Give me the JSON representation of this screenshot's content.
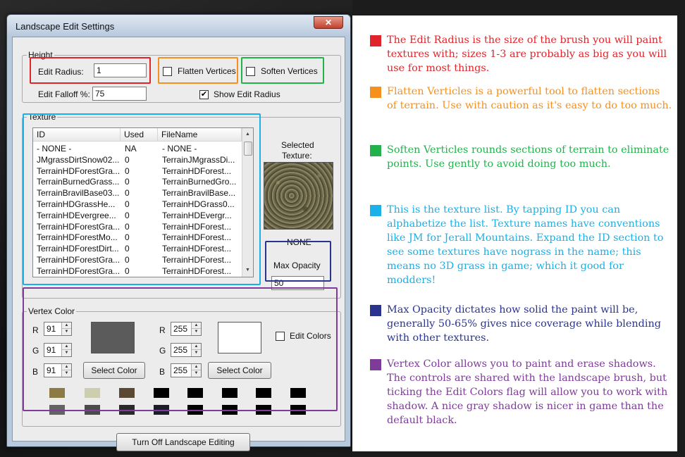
{
  "window": {
    "title": "Landscape Edit Settings",
    "close_glyph": "✕"
  },
  "height_group": {
    "title": "Height",
    "edit_radius_label": "Edit Radius:",
    "edit_radius_value": "1",
    "flatten_label": "Flatten Vertices",
    "soften_label": "Soften Vertices",
    "falloff_label": "Edit Falloff %:",
    "falloff_value": "75",
    "show_radius_label": "Show Edit Radius",
    "show_radius_checked": "✔"
  },
  "texture_group": {
    "title": "Texture",
    "columns": [
      "ID",
      "Used",
      "FileName"
    ],
    "rows": [
      [
        "- NONE -",
        "NA",
        "- NONE -"
      ],
      [
        "JMgrassDirtSnow02...",
        "0",
        "TerrainJMgrassDi..."
      ],
      [
        "TerrainHDForestGra...",
        "0",
        "TerrainHDForest..."
      ],
      [
        "TerrainBurnedGrass...",
        "0",
        "TerrainBurnedGro..."
      ],
      [
        "TerrainBravilBase03...",
        "0",
        "TerrainBravilBase..."
      ],
      [
        "TerrainHDGrassHe...",
        "0",
        "TerrainHDGrass0..."
      ],
      [
        "TerrainHDEvergree...",
        "0",
        "TerrainHDEvergr..."
      ],
      [
        "TerrainHDForestGra...",
        "0",
        "TerrainHDForest..."
      ],
      [
        "TerrainHDForestMo...",
        "0",
        "TerrainHDForest..."
      ],
      [
        "TerrainHDForestDirt...",
        "0",
        "TerrainHDForest..."
      ],
      [
        "TerrainHDForestGra...",
        "0",
        "TerrainHDForest..."
      ],
      [
        "TerrainHDForestGra...",
        "0",
        "TerrainHDForest..."
      ]
    ],
    "selected_label_1": "Selected",
    "selected_label_2": "Texture:",
    "selected_name": "NONE",
    "max_opacity_label": "Max Opacity",
    "max_opacity_value": "50"
  },
  "vertex_group": {
    "title": "Vertex Color",
    "left": {
      "r_label": "R",
      "g_label": "G",
      "b_label": "B",
      "r": "91",
      "g": "91",
      "b": "91",
      "swatch": "#5b5b5b"
    },
    "right": {
      "r_label": "R",
      "g_label": "G",
      "b_label": "B",
      "r": "255",
      "g": "255",
      "b": "255",
      "swatch": "#ffffff"
    },
    "select_color_label": "Select Color",
    "edit_colors_label": "Edit Colors",
    "palette_row1": [
      "#8c7b45",
      "#cdcdb0",
      "#5a4a33",
      "#000000",
      "#000000",
      "#000000",
      "#000000",
      "#000000"
    ],
    "palette_row2": [
      "#646464",
      "#4b4b4b",
      "#2a2a2a",
      "#1c1c2a",
      "#000000",
      "#000000",
      "#000000",
      "#000000"
    ]
  },
  "bottom_button": "Turn Off Landscape Editing",
  "highlight_colors": {
    "red": "#e0242a",
    "orange": "#f5901e",
    "green": "#22b24c",
    "cyan": "#1ab0e8",
    "navy": "#2a3490",
    "purple": "#7d3c98"
  },
  "notes": [
    {
      "color": "#e0242a",
      "text": "The Edit Radius is the size of the brush you will paint textures with; sizes 1-3 are probably as big as you will use for most things."
    },
    {
      "color": "#f5901e",
      "text": "Flatten Verticles is a powerful tool to flatten sections of terrain. Use with caution as it's easy to do too much."
    },
    {
      "color": "#22b24c",
      "text": "Soften Verticles rounds sections of terrain to eliminate points. Use gently to avoid doing too much."
    },
    {
      "color": "#1ab0e8",
      "text": "This is the texture list. By tapping ID you can alphabetize the list. Texture names have conventions like JM for Jerall Mountains. Expand the ID section to see some textures have nograss in the name; this means no 3D grass in game; which it good for modders!"
    },
    {
      "color": "#2a3490",
      "text": "Max Opacity dictates how solid the paint will be, generally 50-65% gives nice coverage while blending with other textures."
    },
    {
      "color": "#7d3c98",
      "text": "Vertex Color allows you to paint and erase shadows. The controls are shared with the landscape brush, but ticking the Edit Colors flag will allow you to work with shadow. A nice gray shadow is nicer in game than the default black."
    }
  ]
}
